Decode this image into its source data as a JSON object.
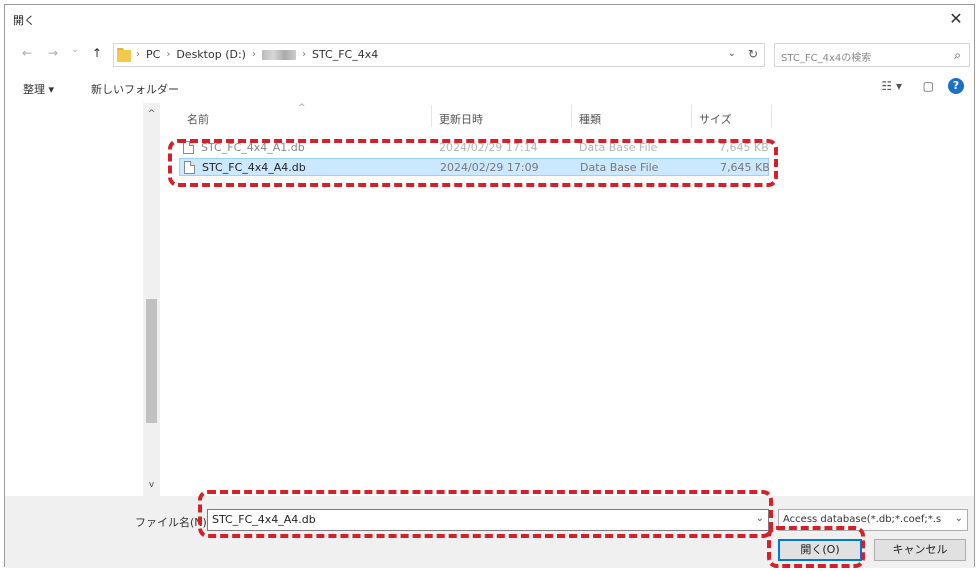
{
  "dialog": {
    "title": "開く",
    "close_glyph": "✕"
  },
  "nav": {
    "back": "←",
    "forward": "→",
    "recent": "⌄",
    "up": "↑"
  },
  "address": {
    "crumbs": [
      "PC",
      "Desktop (D:)",
      "STC_FC_4x4"
    ],
    "dropdown": "⌄",
    "refresh": "↻"
  },
  "search": {
    "placeholder": "STC_FC_4x4の検索",
    "icon": "⌕"
  },
  "toolbar": {
    "organize": "整理 ▾",
    "new_folder": "新しいフォルダー",
    "view": "☷ ▾",
    "preview_pane": "▢",
    "help": "?"
  },
  "columns": {
    "name": "名前",
    "date": "更新日時",
    "type": "種類",
    "size": "サイズ",
    "sort": "^"
  },
  "files": [
    {
      "name": "STC_FC_4x4_A1.db",
      "date": "2024/02/29 17:14",
      "type": "Data Base File",
      "size": "7,645 KB"
    },
    {
      "name": "STC_FC_4x4_A4.db",
      "date": "2024/02/29 17:09",
      "type": "Data Base File",
      "size": "7,645 KB"
    }
  ],
  "scrollbar": {
    "up": "^",
    "down": "v"
  },
  "bottom": {
    "filename_label": "ファイル名(N):",
    "filename_value": "STC_FC_4x4_A4.db",
    "filename_dd": "⌄",
    "filter_value": "Access database(*.db;*.coef;*.s",
    "filter_dd": "⌄",
    "open_label": "開く(O)",
    "cancel_label": "キャンセル"
  },
  "colors": {
    "highlight": "#d3202a",
    "selection": "#cce8ff",
    "accent": "#0078d7"
  }
}
